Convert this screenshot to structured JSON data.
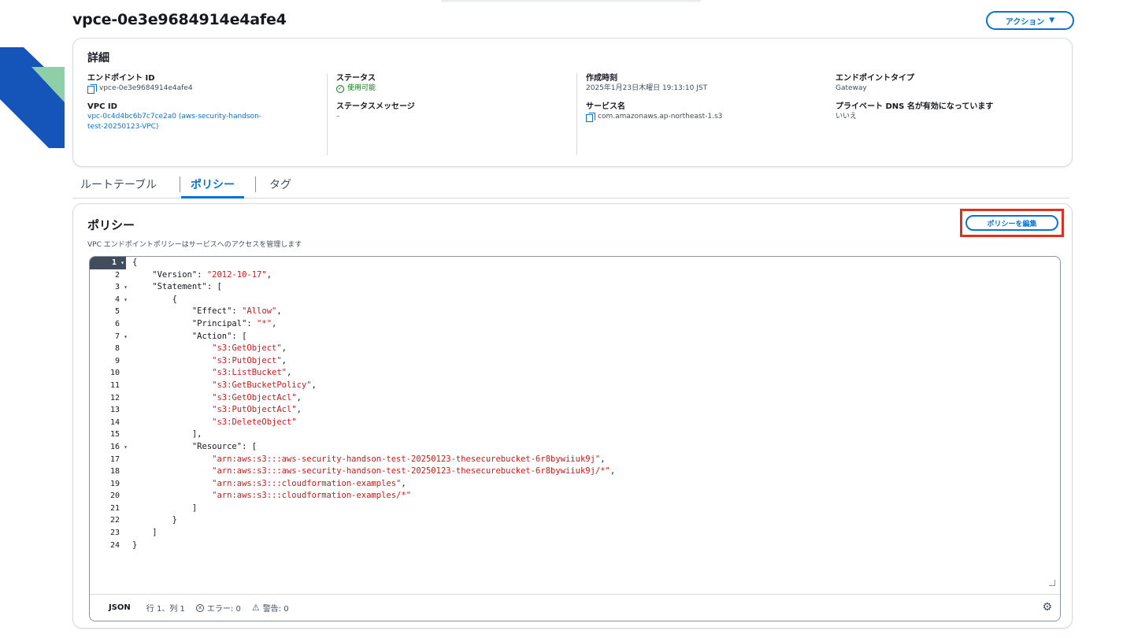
{
  "page": {
    "title": "vpce-0e3e9684914e4afe4",
    "actions_label": "アクション"
  },
  "details": {
    "heading": "詳細",
    "endpoint_id_label": "エンドポイント ID",
    "endpoint_id_value": "vpce-0e3e9684914e4afe4",
    "vpc_id_label": "VPC ID",
    "vpc_id_value_line1": "vpc-0c4d4bc6b7c7ce2a0 (aws-security-handson-",
    "vpc_id_value_line2": "test-20250123-VPC)",
    "status_label": "ステータス",
    "status_value": "使用可能",
    "status_message_label": "ステータスメッセージ",
    "status_message_value": "–",
    "created_label": "作成時刻",
    "created_value": "2025年1月23日木曜日 19:13:10 JST",
    "service_name_label": "サービス名",
    "service_name_value": "com.amazonaws.ap-northeast-1.s3",
    "endpoint_type_label": "エンドポイントタイプ",
    "endpoint_type_value": "Gateway",
    "private_dns_label": "プライベート DNS 名が有効になっています",
    "private_dns_value": "いいえ"
  },
  "tabs": [
    {
      "label": "ルートテーブル"
    },
    {
      "label": "ポリシー"
    },
    {
      "label": "タグ"
    }
  ],
  "policy": {
    "heading": "ポリシー",
    "description": "VPC エンドポイントポリシーはサービスへのアクセスを管理します",
    "edit_label": "ポリシーを編集"
  },
  "code_lines": [
    {
      "n": "1",
      "fold": true,
      "text": "{"
    },
    {
      "n": "2",
      "text": "    \"Version\": ",
      "str": "\"2012-10-17\"",
      "tail": ","
    },
    {
      "n": "3",
      "fold": true,
      "text": "    \"Statement\": ["
    },
    {
      "n": "4",
      "fold": true,
      "text": "        {"
    },
    {
      "n": "5",
      "text": "            \"Effect\": ",
      "str": "\"Allow\"",
      "tail": ","
    },
    {
      "n": "6",
      "text": "            \"Principal\": ",
      "str": "\"*\"",
      "tail": ","
    },
    {
      "n": "7",
      "fold": true,
      "text": "            \"Action\": ["
    },
    {
      "n": "8",
      "text": "                ",
      "str": "\"s3:GetObject\"",
      "tail": ","
    },
    {
      "n": "9",
      "text": "                ",
      "str": "\"s3:PutObject\"",
      "tail": ","
    },
    {
      "n": "10",
      "text": "                ",
      "str": "\"s3:ListBucket\"",
      "tail": ","
    },
    {
      "n": "11",
      "text": "                ",
      "str": "\"s3:GetBucketPolicy\"",
      "tail": ","
    },
    {
      "n": "12",
      "text": "                ",
      "str": "\"s3:GetObjectAcl\"",
      "tail": ","
    },
    {
      "n": "13",
      "text": "                ",
      "str": "\"s3:PutObjectAcl\"",
      "tail": ","
    },
    {
      "n": "14",
      "text": "                ",
      "str": "\"s3:DeleteObject\"",
      "tail": ""
    },
    {
      "n": "15",
      "text": "            ],"
    },
    {
      "n": "16",
      "fold": true,
      "text": "            \"Resource\": ["
    },
    {
      "n": "17",
      "text": "                ",
      "str": "\"arn:aws:s3:::aws-security-handson-test-20250123-thesecurebucket-6r8bywiiuk9j\"",
      "tail": ","
    },
    {
      "n": "18",
      "text": "                ",
      "str": "\"arn:aws:s3:::aws-security-handson-test-20250123-thesecurebucket-6r8bywiiuk9j/*\"",
      "tail": ","
    },
    {
      "n": "19",
      "text": "                ",
      "str": "\"arn:aws:s3:::cloudformation-examples\"",
      "tail": ","
    },
    {
      "n": "20",
      "text": "                ",
      "str": "\"arn:aws:s3:::cloudformation-examples/*\"",
      "tail": ""
    },
    {
      "n": "21",
      "text": "            ]"
    },
    {
      "n": "22",
      "text": "        }"
    },
    {
      "n": "23",
      "text": "    ]"
    },
    {
      "n": "24",
      "text": "}"
    }
  ],
  "status_bar": {
    "language": "JSON",
    "position": "行 1、列 1",
    "errors": "エラー: 0",
    "warnings": "警告: 0"
  },
  "colors": {
    "accent": "#0972d3",
    "highlight_frame": "#e0301e",
    "string": "#d91515",
    "success": "#037f0c"
  }
}
